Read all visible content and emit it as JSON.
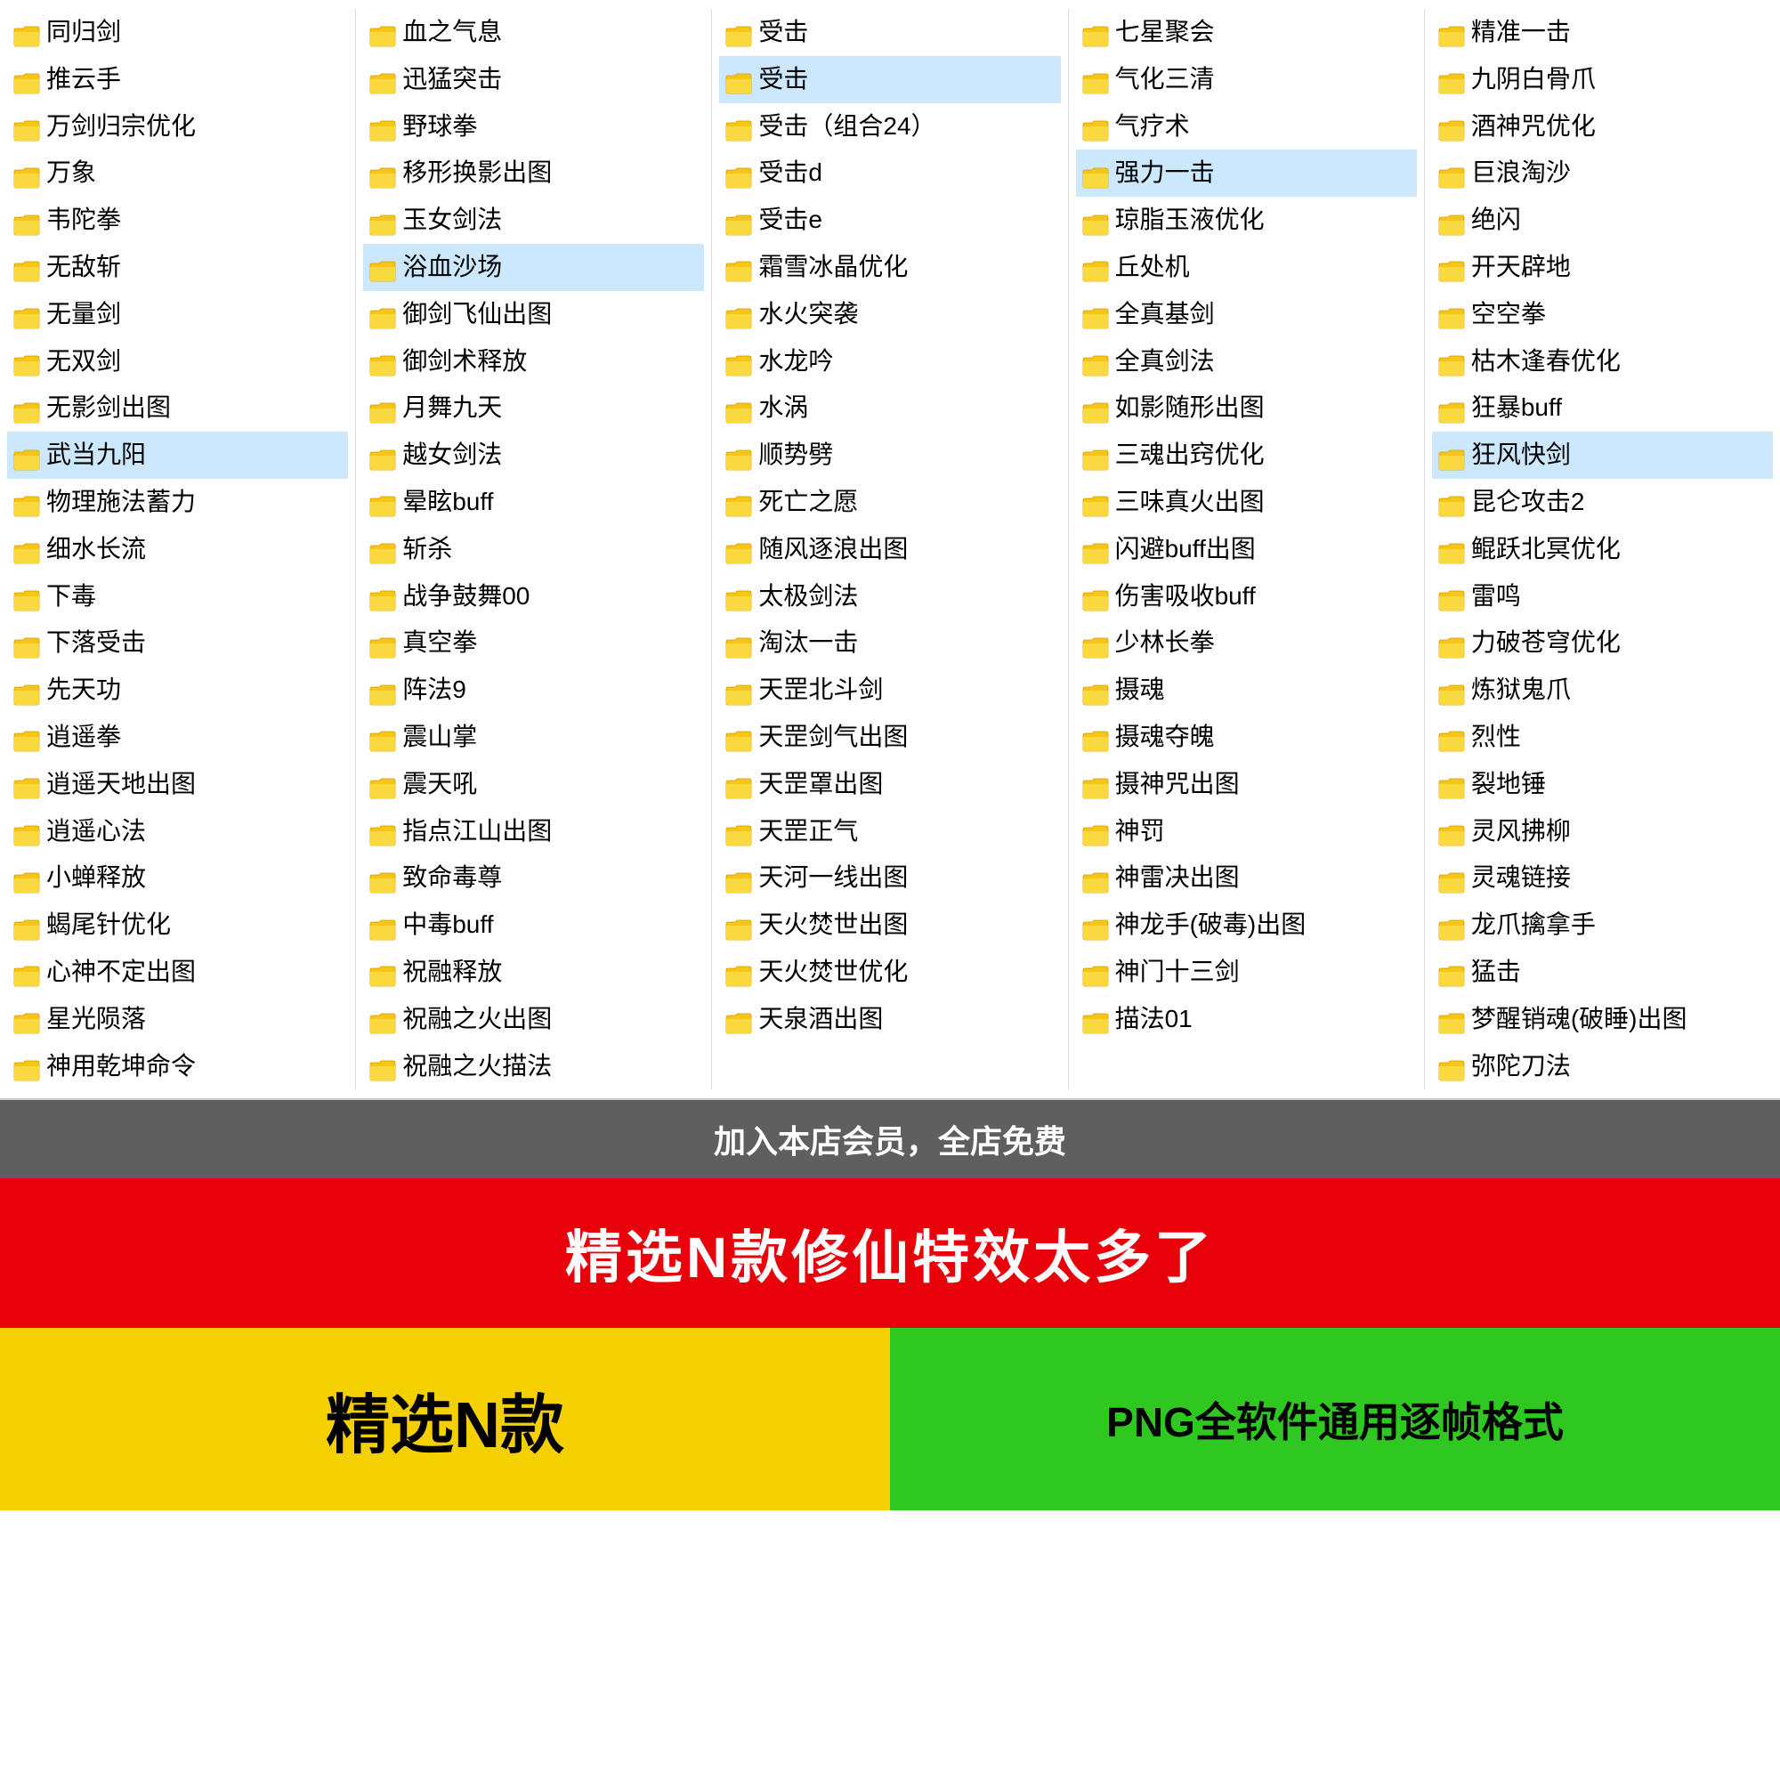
{
  "columns": [
    {
      "id": "col1",
      "items": [
        {
          "label": "同归剑",
          "selected": false
        },
        {
          "label": "推云手",
          "selected": false
        },
        {
          "label": "万剑归宗优化",
          "selected": false
        },
        {
          "label": "万象",
          "selected": false
        },
        {
          "label": "韦陀拳",
          "selected": false
        },
        {
          "label": "无敌斩",
          "selected": false
        },
        {
          "label": "无量剑",
          "selected": false
        },
        {
          "label": "无双剑",
          "selected": false
        },
        {
          "label": "无影剑出图",
          "selected": false
        },
        {
          "label": "武当九阳",
          "selected": true
        },
        {
          "label": "物理施法蓄力",
          "selected": false
        },
        {
          "label": "细水长流",
          "selected": false
        },
        {
          "label": "下毒",
          "selected": false
        },
        {
          "label": "下落受击",
          "selected": false
        },
        {
          "label": "先天功",
          "selected": false
        },
        {
          "label": "逍遥拳",
          "selected": false
        },
        {
          "label": "逍遥天地出图",
          "selected": false
        },
        {
          "label": "逍遥心法",
          "selected": false
        },
        {
          "label": "小蝉释放",
          "selected": false
        },
        {
          "label": "蝎尾针优化",
          "selected": false
        },
        {
          "label": "心神不定出图",
          "selected": false
        },
        {
          "label": "星光陨落",
          "selected": false
        },
        {
          "label": "神用乾坤命令",
          "selected": false
        }
      ]
    },
    {
      "id": "col2",
      "items": [
        {
          "label": "血之气息",
          "selected": false
        },
        {
          "label": "迅猛突击",
          "selected": false
        },
        {
          "label": "野球拳",
          "selected": false
        },
        {
          "label": "移形换影出图",
          "selected": false
        },
        {
          "label": "玉女剑法",
          "selected": false
        },
        {
          "label": "浴血沙场",
          "selected": true
        },
        {
          "label": "御剑飞仙出图",
          "selected": false
        },
        {
          "label": "御剑术释放",
          "selected": false
        },
        {
          "label": "月舞九天",
          "selected": false
        },
        {
          "label": "越女剑法",
          "selected": false
        },
        {
          "label": "晕眩buff",
          "selected": false
        },
        {
          "label": "斩杀",
          "selected": false
        },
        {
          "label": "战争鼓舞00",
          "selected": false
        },
        {
          "label": "真空拳",
          "selected": false
        },
        {
          "label": "阵法9",
          "selected": false
        },
        {
          "label": "震山掌",
          "selected": false
        },
        {
          "label": "震天吼",
          "selected": false
        },
        {
          "label": "指点江山出图",
          "selected": false
        },
        {
          "label": "致命毒尊",
          "selected": false
        },
        {
          "label": "中毒buff",
          "selected": false
        },
        {
          "label": "祝融释放",
          "selected": false
        },
        {
          "label": "祝融之火出图",
          "selected": false
        },
        {
          "label": "祝融之火描法",
          "selected": false
        }
      ]
    },
    {
      "id": "col3",
      "items": [
        {
          "label": "受击",
          "selected": false
        },
        {
          "label": "受击",
          "selected": true
        },
        {
          "label": "受击（组合24）",
          "selected": false
        },
        {
          "label": "受击d",
          "selected": false
        },
        {
          "label": "受击e",
          "selected": false
        },
        {
          "label": "霜雪冰晶优化",
          "selected": false
        },
        {
          "label": "水火突袭",
          "selected": false
        },
        {
          "label": "水龙吟",
          "selected": false
        },
        {
          "label": "水涡",
          "selected": false
        },
        {
          "label": "顺势劈",
          "selected": false
        },
        {
          "label": "死亡之愿",
          "selected": false
        },
        {
          "label": "随风逐浪出图",
          "selected": false
        },
        {
          "label": "太极剑法",
          "selected": false
        },
        {
          "label": "淘汰一击",
          "selected": false
        },
        {
          "label": "天罡北斗剑",
          "selected": false
        },
        {
          "label": "天罡剑气出图",
          "selected": false
        },
        {
          "label": "天罡罩出图",
          "selected": false
        },
        {
          "label": "天罡正气",
          "selected": false
        },
        {
          "label": "天河一线出图",
          "selected": false
        },
        {
          "label": "天火焚世出图",
          "selected": false
        },
        {
          "label": "天火焚世优化",
          "selected": false
        },
        {
          "label": "天泉酒出图",
          "selected": false
        }
      ]
    },
    {
      "id": "col4",
      "items": [
        {
          "label": "七星聚会",
          "selected": false
        },
        {
          "label": "气化三清",
          "selected": false
        },
        {
          "label": "气疗术",
          "selected": false
        },
        {
          "label": "强力一击",
          "selected": true
        },
        {
          "label": "琼脂玉液优化",
          "selected": false
        },
        {
          "label": "丘处机",
          "selected": false
        },
        {
          "label": "全真基剑",
          "selected": false
        },
        {
          "label": "全真剑法",
          "selected": false
        },
        {
          "label": "如影随形出图",
          "selected": false
        },
        {
          "label": "三魂出窍优化",
          "selected": false
        },
        {
          "label": "三味真火出图",
          "selected": false
        },
        {
          "label": "闪避buff出图",
          "selected": false
        },
        {
          "label": "伤害吸收buff",
          "selected": false
        },
        {
          "label": "少林长拳",
          "selected": false
        },
        {
          "label": "摄魂",
          "selected": false
        },
        {
          "label": "摄魂夺魄",
          "selected": false
        },
        {
          "label": "摄神咒出图",
          "selected": false
        },
        {
          "label": "神罚",
          "selected": false
        },
        {
          "label": "神雷决出图",
          "selected": false
        },
        {
          "label": "神龙手(破毒)出图",
          "selected": false
        },
        {
          "label": "神门十三剑",
          "selected": false
        },
        {
          "label": "描法01",
          "selected": false
        }
      ]
    },
    {
      "id": "col5",
      "items": [
        {
          "label": "精准一击",
          "selected": false
        },
        {
          "label": "九阴白骨爪",
          "selected": false
        },
        {
          "label": "酒神咒优化",
          "selected": false
        },
        {
          "label": "巨浪淘沙",
          "selected": false
        },
        {
          "label": "绝闪",
          "selected": false
        },
        {
          "label": "开天辟地",
          "selected": false
        },
        {
          "label": "空空拳",
          "selected": false
        },
        {
          "label": "枯木逢春优化",
          "selected": false
        },
        {
          "label": "狂暴buff",
          "selected": false
        },
        {
          "label": "狂风快剑",
          "selected": true
        },
        {
          "label": "昆仑攻击2",
          "selected": false
        },
        {
          "label": "鲲跃北冥优化",
          "selected": false
        },
        {
          "label": "雷鸣",
          "selected": false
        },
        {
          "label": "力破苍穹优化",
          "selected": false
        },
        {
          "label": "炼狱鬼爪",
          "selected": false
        },
        {
          "label": "烈性",
          "selected": false
        },
        {
          "label": "裂地锤",
          "selected": false
        },
        {
          "label": "灵风拂柳",
          "selected": false
        },
        {
          "label": "灵魂链接",
          "selected": false
        },
        {
          "label": "龙爪擒拿手",
          "selected": false
        },
        {
          "label": "猛击",
          "selected": false
        },
        {
          "label": "梦醒销魂(破睡)出图",
          "selected": false
        },
        {
          "label": "弥陀刀法",
          "selected": false
        }
      ]
    }
  ],
  "overlay": {
    "text": "加入本店会员，全店免费"
  },
  "red_banner": {
    "text": "精选N款修仙特效太多了"
  },
  "yellow_box": {
    "text": "精选N款"
  },
  "green_box": {
    "text": "PNG全软件通用逐帧格式"
  }
}
